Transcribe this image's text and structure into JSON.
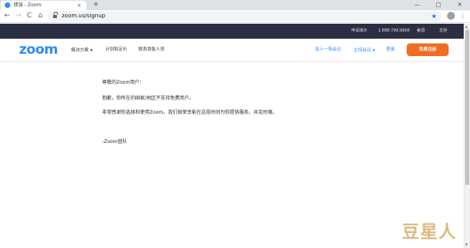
{
  "browser": {
    "tab_title": "错误 - Zoom",
    "tab_close": "×",
    "new_tab": "+",
    "url": "zoom.us/signup",
    "window_controls": [
      "—",
      "□",
      "✕"
    ],
    "nav": {
      "back": "←",
      "forward": "→",
      "reload": "C",
      "home": "⌂"
    },
    "star": "★",
    "menu": "⋮"
  },
  "topbar": {
    "demo": "申请演示",
    "phone": "1.888.799.9666",
    "resources": "资源",
    "support": "支持"
  },
  "navbar": {
    "logo": "zoom",
    "links": [
      "解决方案",
      "计划和定价",
      "联系销售人员"
    ],
    "join": "加入一场会议",
    "host": "主持会议",
    "signin": "登录",
    "signup": "免费注册"
  },
  "content": {
    "greeting": "尊敬的Zoom用户：",
    "line1": "抱歉，你所在的国家/地区不支持免费用户。",
    "line2": "非常感谢你选择和使用Zoom，我们很荣幸能在这段时间为你提供服务，共克时艰。",
    "signature": "-Zoom团队"
  },
  "watermark": "豆星人",
  "colors": {
    "brand": "#2d8cff",
    "signup": "#f26d21",
    "topbar": "#2c2f41"
  }
}
